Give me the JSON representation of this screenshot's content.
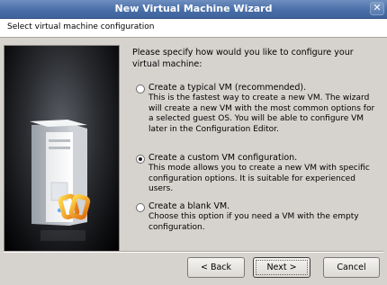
{
  "window": {
    "title": "New Virtual Machine Wizard",
    "close_glyph": "✕"
  },
  "header": {
    "text": "Select virtual machine configuration"
  },
  "main": {
    "intro": "Please specify how would you like to configure your virtual machine:",
    "options": [
      {
        "label": "Create a typical VM (recommended).",
        "description": "This is the fastest way to create a new VM. The wizard will create a new VM with the most common options for a selected guest OS. You will be able to configure VM later in the Configuration Editor.",
        "selected": false
      },
      {
        "label": "Create a custom VM configuration.",
        "description": "This mode allows you to create a new VM with specific configuration options. It is suitable for experienced users.",
        "selected": true
      },
      {
        "label": "Create a blank VM.",
        "description": "Choose this option if you need a VM with the empty configuration.",
        "selected": false
      }
    ]
  },
  "buttons": {
    "back": "< Back",
    "next": "Next >",
    "cancel": "Cancel"
  },
  "icons": {
    "window_close": "close-icon",
    "illustration": "computer-tower-illustration",
    "logo": "parallels-logo-icon"
  },
  "colors": {
    "titlebar": "#4a6fa8",
    "logo_orange": "#f0a020"
  }
}
